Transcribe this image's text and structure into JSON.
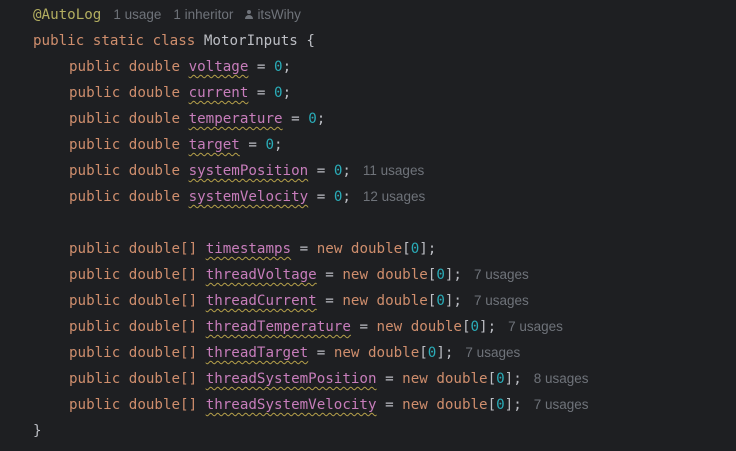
{
  "editor": {
    "annotation": "@AutoLog",
    "inlay": {
      "usages": "1 usage",
      "inheritors": "1 inheritor",
      "author": "itsWihy"
    },
    "class_decl": {
      "kw_public": "public",
      "kw_static": "static",
      "kw_class": "class",
      "name": "MotorInputs",
      "open_brace": "{"
    },
    "fields": [
      {
        "type": "double",
        "name": "voltage",
        "init_num": "0",
        "hint": ""
      },
      {
        "type": "double",
        "name": "current",
        "init_num": "0",
        "hint": ""
      },
      {
        "type": "double",
        "name": "temperature",
        "init_num": "0",
        "hint": ""
      },
      {
        "type": "double",
        "name": "target",
        "init_num": "0",
        "hint": ""
      },
      {
        "type": "double",
        "name": "systemPosition",
        "init_num": "0",
        "hint": "11 usages"
      },
      {
        "type": "double",
        "name": "systemVelocity",
        "init_num": "0",
        "hint": "12 usages"
      }
    ],
    "array_fields": [
      {
        "type": "double[]",
        "name": "timestamps",
        "init_kw": "new",
        "init_type": "double",
        "size": "0",
        "hint": ""
      },
      {
        "type": "double[]",
        "name": "threadVoltage",
        "init_kw": "new",
        "init_type": "double",
        "size": "0",
        "hint": "7 usages"
      },
      {
        "type": "double[]",
        "name": "threadCurrent",
        "init_kw": "new",
        "init_type": "double",
        "size": "0",
        "hint": "7 usages"
      },
      {
        "type": "double[]",
        "name": "threadTemperature",
        "init_kw": "new",
        "init_type": "double",
        "size": "0",
        "hint": "7 usages"
      },
      {
        "type": "double[]",
        "name": "threadTarget",
        "init_kw": "new",
        "init_type": "double",
        "size": "0",
        "hint": "7 usages"
      },
      {
        "type": "double[]",
        "name": "threadSystemPosition",
        "init_kw": "new",
        "init_type": "double",
        "size": "0",
        "hint": "8 usages"
      },
      {
        "type": "double[]",
        "name": "threadSystemVelocity",
        "init_kw": "new",
        "init_type": "double",
        "size": "0",
        "hint": "7 usages"
      }
    ],
    "keyword_public": "public",
    "close_brace": "}",
    "icons": {
      "author": "person-icon"
    },
    "colors": {
      "background": "#1e1f22",
      "keyword": "#cf8e6d",
      "annotation": "#b3ae60",
      "field": "#c77dbb",
      "number": "#2aacb8",
      "text": "#bcbec4",
      "hint": "#6f737a"
    }
  }
}
